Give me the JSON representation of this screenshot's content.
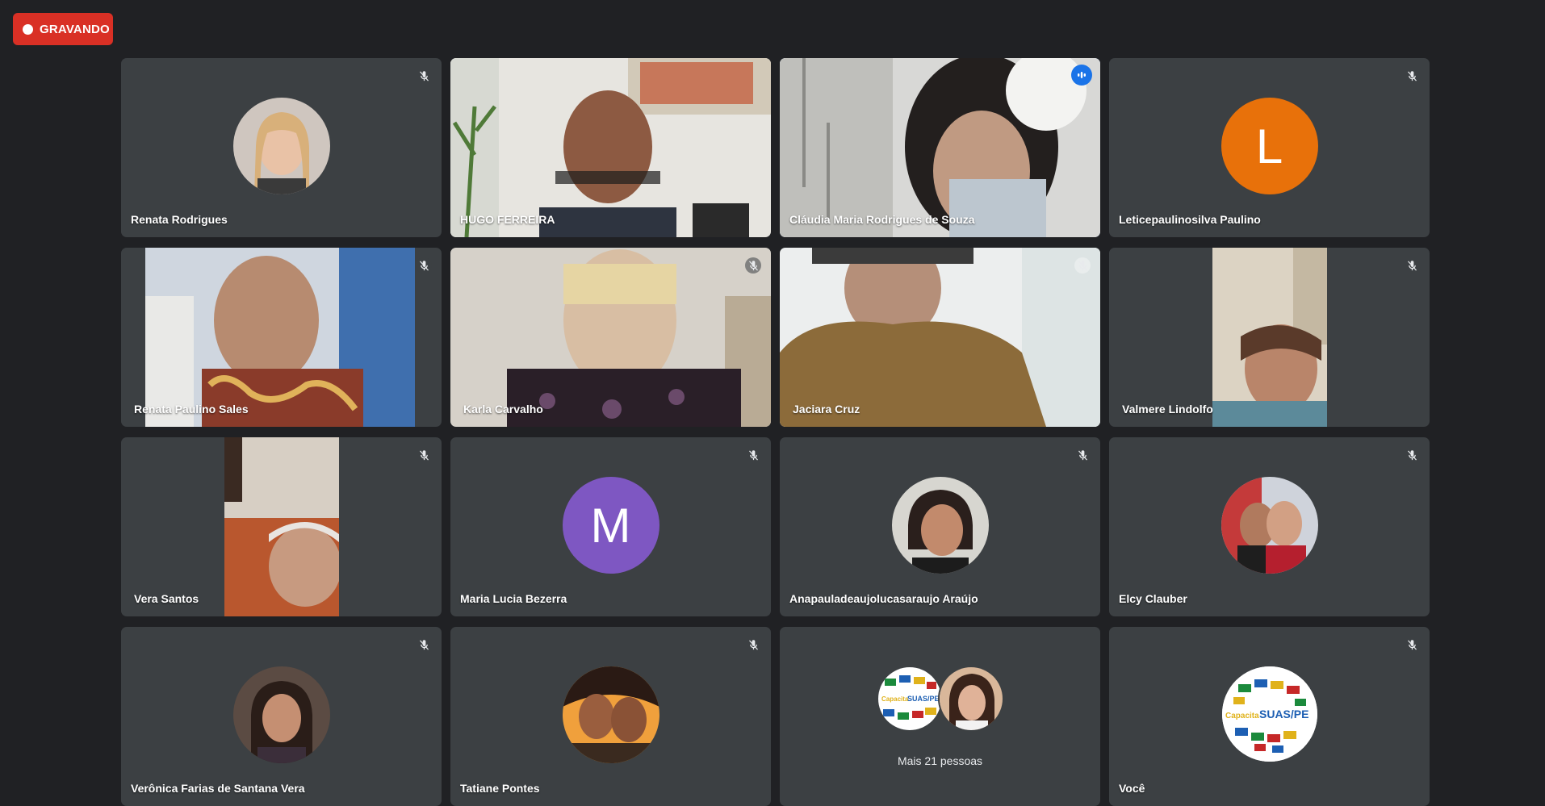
{
  "recording": {
    "label": "GRAVANDO"
  },
  "participants": [
    {
      "name": "Renata Rodrigues",
      "type": "avatar-photo"
    },
    {
      "name": "HUGO FERREIRA",
      "type": "video"
    },
    {
      "name": "Cláudia Maria Rodrigues de Souza",
      "type": "video",
      "speaking": true
    },
    {
      "name": "Leticepaulinosilva Paulino",
      "type": "letter",
      "letter": "L",
      "color": "#e8710a"
    },
    {
      "name": "Renata Paulino Sales",
      "type": "video"
    },
    {
      "name": "Karla Carvalho",
      "type": "video"
    },
    {
      "name": "Jaciara Cruz",
      "type": "video"
    },
    {
      "name": "Valmere Lindolfo",
      "type": "video"
    },
    {
      "name": "Vera Santos",
      "type": "video"
    },
    {
      "name": "Maria Lucia Bezerra",
      "type": "letter",
      "letter": "M",
      "color": "#7e57c2"
    },
    {
      "name": "Anapauladeaujolucasaraujo Araújo",
      "type": "avatar-photo"
    },
    {
      "name": "Elcy Clauber",
      "type": "avatar-photo"
    },
    {
      "name": "Verônica Farias de Santana Vera",
      "type": "avatar-photo"
    },
    {
      "name": "Tatiane Pontes",
      "type": "avatar-photo"
    },
    {
      "more_label": "Mais 21 pessoas",
      "type": "more"
    },
    {
      "name": "Você",
      "type": "logo"
    }
  ],
  "logo_text": {
    "prefix": "Capacita",
    "main": "SUAS/PE"
  },
  "colors": {
    "background": "#202124",
    "tile": "#3c4043",
    "recording": "#d93025",
    "speaking_border": "#8ab4f8"
  }
}
